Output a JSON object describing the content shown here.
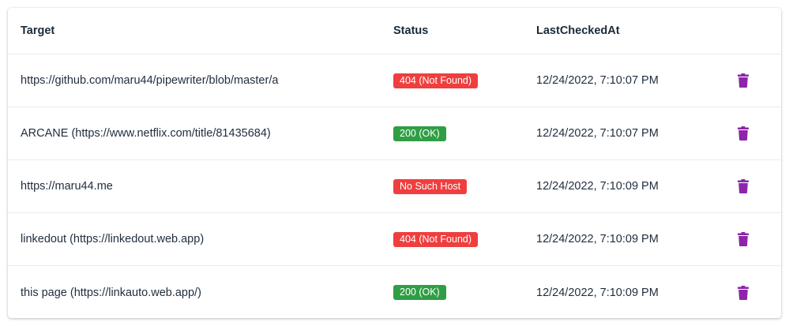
{
  "table": {
    "headers": {
      "target": "Target",
      "status": "Status",
      "last_checked": "LastCheckedAt"
    },
    "rows": [
      {
        "target": "https://github.com/maru44/pipewriter/blob/master/a",
        "status": "404 (Not Found)",
        "status_kind": "err",
        "last_checked": "12/24/2022, 7:10:07 PM"
      },
      {
        "target": "ARCANE (https://www.netflix.com/title/81435684)",
        "status": "200 (OK)",
        "status_kind": "ok",
        "last_checked": "12/24/2022, 7:10:07 PM"
      },
      {
        "target": "https://maru44.me",
        "status": "No Such Host",
        "status_kind": "err",
        "last_checked": "12/24/2022, 7:10:09 PM"
      },
      {
        "target": "linkedout (https://linkedout.web.app)",
        "status": "404 (Not Found)",
        "status_kind": "err",
        "last_checked": "12/24/2022, 7:10:09 PM"
      },
      {
        "target": "this page (https://linkauto.web.app/)",
        "status": "200 (OK)",
        "status_kind": "ok",
        "last_checked": "12/24/2022, 7:10:09 PM"
      }
    ],
    "delete_icon": "trash-icon"
  },
  "colors": {
    "ok": "#2f9e44",
    "error": "#f03e3e",
    "delete_icon": "#8e24aa"
  }
}
